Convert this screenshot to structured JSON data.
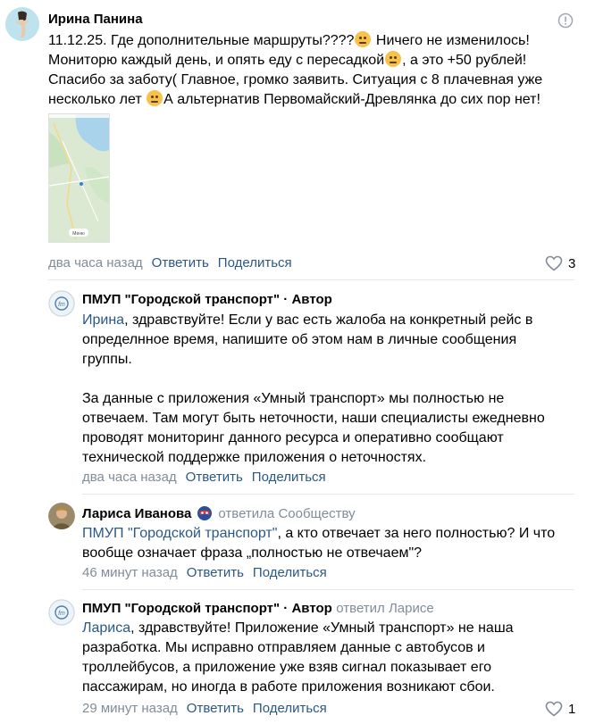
{
  "comment1": {
    "author": "Ирина Панина",
    "line1_pre": "11.12.25. Где дополнительные маршруты????",
    "line1_post": " Ничего не изменилось!",
    "line2_pre": "Мониторю каждый день, и опять еду с пересадкой",
    "line2_post": ", а это +50 рублей!",
    "line3": "Спасибо за заботу( Главное, громко заявить. Ситуация с 8 плачевная уже",
    "line4_pre": "несколько лет ",
    "line4_post": "А альтернатив Первомайский-Древлянка до сих пор нет!",
    "time": "два часа назад",
    "reply": "Ответить",
    "share": "Поделиться",
    "likes": "3",
    "map_button": "Меню"
  },
  "reply1": {
    "author": "ПМУП \"Городской транспорт\"",
    "author_badge": " · Автор",
    "mention": "Ирина",
    "line1": ", здравствуйте! Если у вас есть жалоба на конкретный рейс в",
    "line2": "определнное время, напишите об этом нам в личные сообщения",
    "line3": "группы.",
    "line4": "За данные с приложения «Умный транспорт» мы полностью не",
    "line5": "отвечаем. Там могут быть неточности, наши специалисты ежедневно",
    "line6": "проводят мониторинг данного ресурса и оперативно сообщают",
    "line7": "технической поддержке приложения о неточностях.",
    "time": "два часа назад",
    "reply": "Ответить",
    "share": "Поделиться"
  },
  "reply2": {
    "author": "Лариса Иванова",
    "replied_to": "ответила Сообществу",
    "mention": "ПМУП \"Городской транспорт\"",
    "line1": ", а кто отвечает за него полностью? И что",
    "line2": "вообще означает фраза „полностью не отвечаем\"?",
    "time": "46 минут назад",
    "reply": "Ответить",
    "share": "Поделиться"
  },
  "reply3": {
    "author": "ПМУП \"Городской транспорт\"",
    "author_badge": " · Автор",
    "replied_to": "ответил Ларисе",
    "mention": "Лариса",
    "line1": ", здравствуйте! Приложение «Умный транспорт» не наша",
    "line2": "разработка. Мы исправно отправляем данные с автобусов и",
    "line3": "троллейбусов, а приложение уже взяв сигнал показывает его",
    "line4": "пассажирам, но иногда в работе приложения возникают сбои.",
    "time": "29 минут назад",
    "reply": "Ответить",
    "share": "Поделиться",
    "likes": "1"
  },
  "icons": {
    "report": "exclamation-circle-icon",
    "like": "heart-icon",
    "community_avatar": "gm-logo-icon",
    "map": "map-thumbnail"
  },
  "colors": {
    "link": "#2a5885",
    "meta": "#818c99",
    "divider": "#e7e8ec"
  }
}
